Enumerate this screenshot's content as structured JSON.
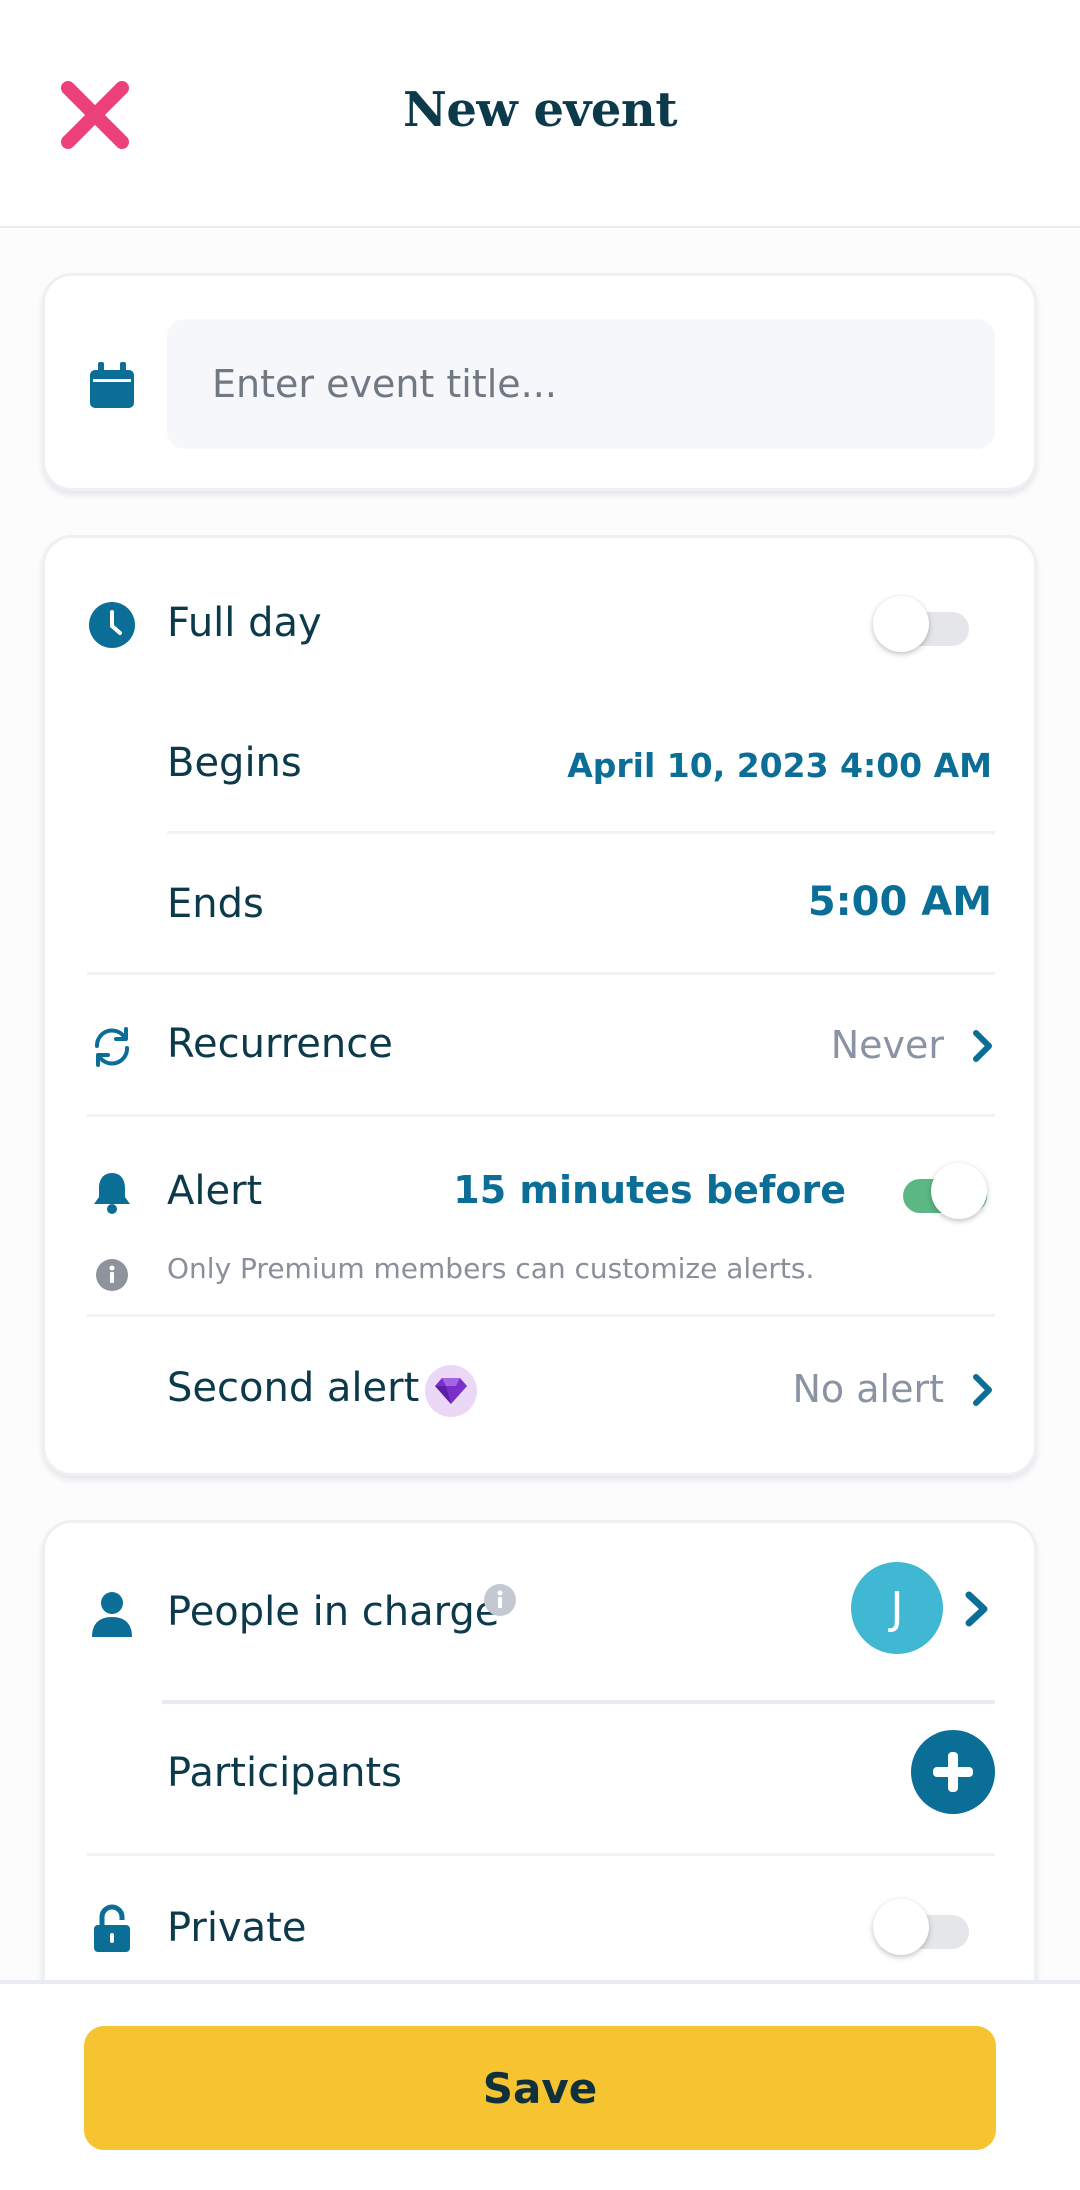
{
  "header": {
    "title": "New event"
  },
  "title_card": {
    "placeholder": "Enter event title..."
  },
  "time_card": {
    "full_day_label": "Full day",
    "full_day_on": false,
    "begins_label": "Begins",
    "begins_value": "April 10, 2023 4:00 AM",
    "ends_label": "Ends",
    "ends_value": "5:00 AM",
    "recurrence_label": "Recurrence",
    "recurrence_value": "Never",
    "alert_label": "Alert",
    "alert_value": "15 minutes before",
    "alert_on": true,
    "alert_note": "Only Premium members can customize alerts.",
    "second_alert_label": "Second alert",
    "second_alert_value": "No alert"
  },
  "people_card": {
    "people_label": "People in charge",
    "avatar_initial": "J",
    "participants_label": "Participants",
    "private_label": "Private",
    "private_on": false
  },
  "footer": {
    "save_label": "Save"
  },
  "colors": {
    "accent": "#0b6e96",
    "close": "#ec407a",
    "save": "#f6c431",
    "toggle_on": "#5cb883",
    "avatar": "#40b8d3"
  }
}
